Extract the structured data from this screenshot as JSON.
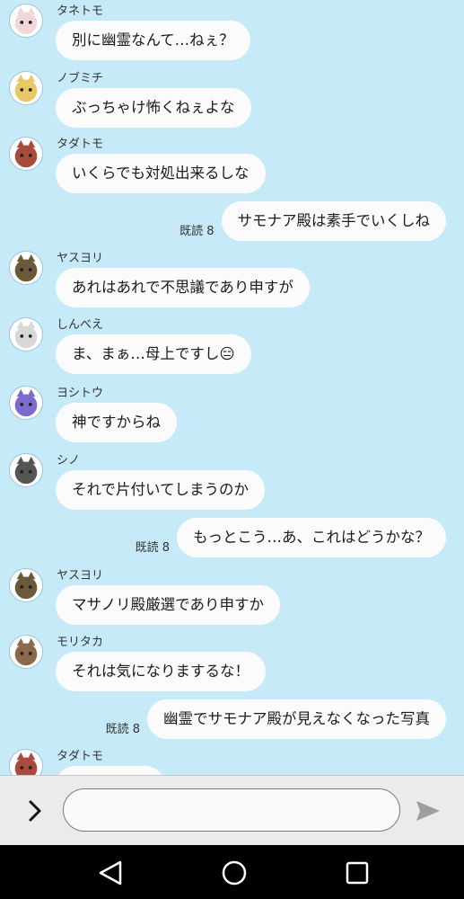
{
  "chat": {
    "messages": [
      {
        "type": "incoming",
        "sender": "タネトモ",
        "text": "別に幽霊なんて…ねぇ？",
        "avatar_color": "#f0d8d8"
      },
      {
        "type": "incoming",
        "sender": "ノブミチ",
        "text": "ぶっちゃけ怖くねぇよな",
        "avatar_color": "#e8c866"
      },
      {
        "type": "incoming",
        "sender": "タダトモ",
        "text": "いくらでも対処出来るしな",
        "avatar_color": "#a84a3c"
      },
      {
        "type": "outgoing",
        "text": "サモナア殿は素手でいくしね",
        "read_receipt": "既読 8"
      },
      {
        "type": "incoming",
        "sender": "ヤスヨリ",
        "text": "あれはあれで不思議であり申すが",
        "avatar_color": "#6a5a3a"
      },
      {
        "type": "incoming",
        "sender": "しんべえ",
        "text": "ま、まぁ…母上ですし😑",
        "avatar_color": "#d8d8d8"
      },
      {
        "type": "incoming",
        "sender": "ヨシトウ",
        "text": "神ですからね",
        "avatar_color": "#7c6ad0"
      },
      {
        "type": "incoming",
        "sender": "シノ",
        "text": "それで片付いてしまうのか",
        "avatar_color": "#555555"
      },
      {
        "type": "outgoing",
        "text": "もっとこう…あ、これはどうかな？",
        "read_receipt": "既読 8"
      },
      {
        "type": "incoming",
        "sender": "ヤスヨリ",
        "text": "マサノリ殿厳選であり申すか",
        "avatar_color": "#6a5a3a"
      },
      {
        "type": "incoming",
        "sender": "モリタカ",
        "text": "それは気になりまするな！",
        "avatar_color": "#8a6a4a"
      },
      {
        "type": "outgoing",
        "text": "幽霊でサモナア殿が見えなくなった写真",
        "read_receipt": "既読 8"
      },
      {
        "type": "incoming",
        "sender": "タダトモ",
        "text": "",
        "avatar_color": "#a84a3c"
      }
    ]
  },
  "input_bar": {
    "expand_icon": "chevron-right-icon",
    "message_value": "",
    "send_icon": "send-icon"
  },
  "navbar": {
    "icons": [
      "back-triangle-icon",
      "home-circle-icon",
      "recents-square-icon"
    ]
  },
  "colors": {
    "background": "#c6eaf7",
    "bubble": "#fbfbfb",
    "input_bar": "#ebebeb",
    "navbar": "#000000"
  }
}
